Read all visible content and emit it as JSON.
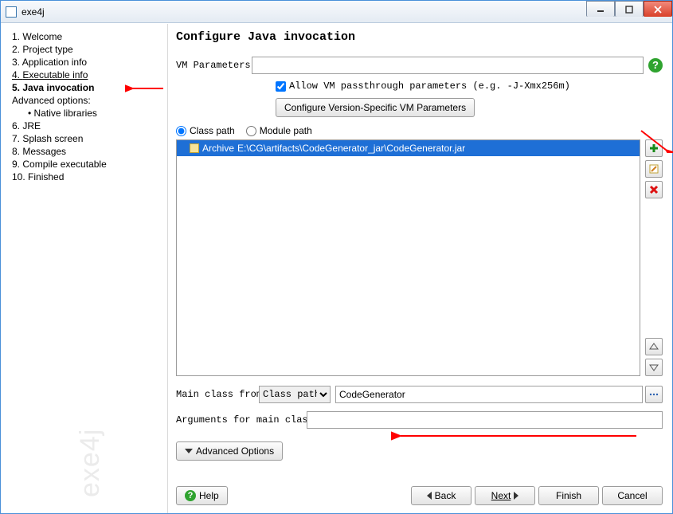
{
  "window": {
    "title": "exe4j"
  },
  "sidebar": {
    "steps": [
      {
        "num": "1.",
        "label": "Welcome"
      },
      {
        "num": "2.",
        "label": "Project type"
      },
      {
        "num": "3.",
        "label": "Application info"
      },
      {
        "num": "4.",
        "label": "Executable info",
        "underline": true
      },
      {
        "num": "5.",
        "label": "Java invocation",
        "active": true
      },
      {
        "num": "6.",
        "label": "JRE"
      },
      {
        "num": "7.",
        "label": "Splash screen"
      },
      {
        "num": "8.",
        "label": "Messages"
      },
      {
        "num": "9.",
        "label": "Compile executable"
      },
      {
        "num": "10.",
        "label": "Finished"
      }
    ],
    "advanced_label": "Advanced options:",
    "advanced_items": [
      "Native libraries"
    ],
    "watermark": "exe4j"
  },
  "main": {
    "heading": "Configure Java invocation",
    "vm_params_label": "VM Parameters:",
    "vm_params_value": "",
    "allow_passthrough": "Allow VM passthrough parameters (e.g. -J-Xmx256m)",
    "allow_passthrough_checked": true,
    "config_version_btn": "Configure Version-Specific VM Parameters",
    "radios": {
      "classpath": "Class path",
      "modulepath": "Module path",
      "selected": "classpath"
    },
    "list": {
      "item_prefix": "Archive",
      "item_path": "E:\\CG\\artifacts\\CodeGenerator_jar\\CodeGenerator.jar"
    },
    "mainclass_label": "Main class from",
    "mainclass_select": "Class path",
    "mainclass_value": "CodeGenerator",
    "args_label": "Arguments for main class:",
    "args_value": "",
    "adv_options_btn": "Advanced Options"
  },
  "footer": {
    "help": "Help",
    "back": "Back",
    "next": "Next",
    "finish": "Finish",
    "cancel": "Cancel"
  },
  "colors": {
    "highlight": "#1e6fd6",
    "close_red": "#d9412a",
    "arrow_red": "#ff0000",
    "help_green": "#2fa32f"
  }
}
